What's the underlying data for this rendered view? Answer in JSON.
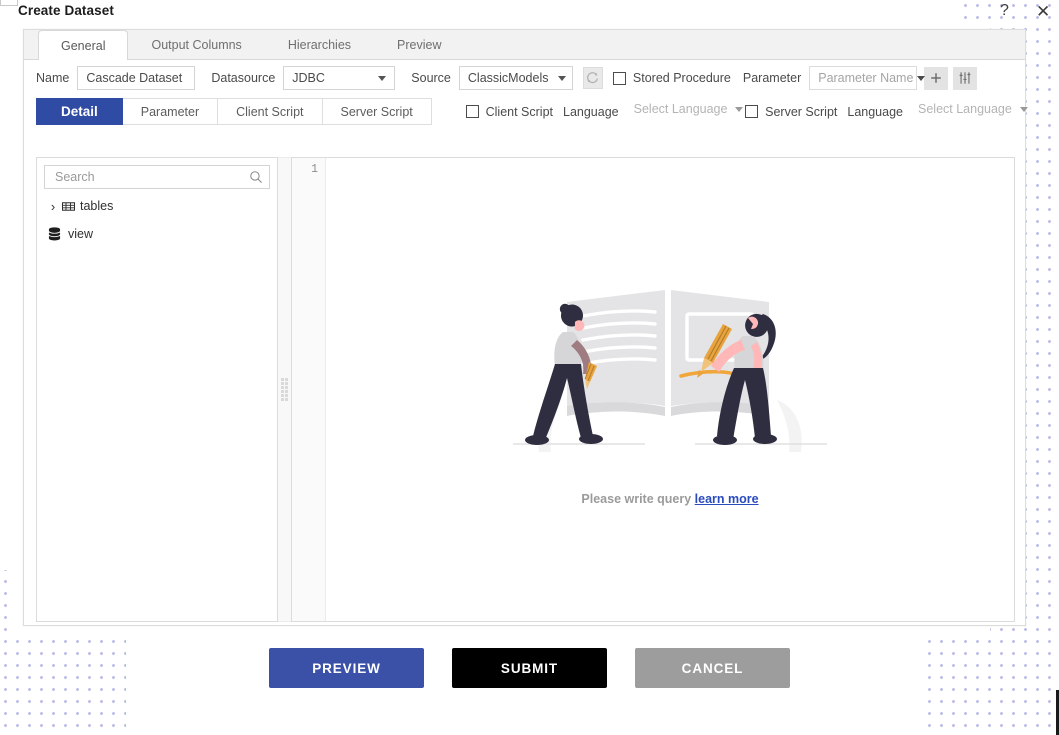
{
  "window": {
    "title": "Create Dataset",
    "help_icon": "question-mark-icon",
    "close_icon": "close-icon"
  },
  "top_tabs": [
    {
      "label": "General",
      "active": true
    },
    {
      "label": "Output Columns",
      "active": false
    },
    {
      "label": "Hierarchies",
      "active": false
    },
    {
      "label": "Preview",
      "active": false
    }
  ],
  "form": {
    "name_label": "Name",
    "name_value": "Cascade Dataset",
    "name_placeholder": "Name",
    "datasource_label": "Datasource",
    "datasource_value": "JDBC",
    "source_label": "Source",
    "source_value": "ClassicModels",
    "refresh_icon": "refresh-icon",
    "stored_procedure_label": "Stored Procedure",
    "stored_procedure_checked": false,
    "parameter_label": "Parameter",
    "parameter_name_value": "Parameter Name",
    "add_icon": "plus-icon",
    "settings_icon": "sliders-icon"
  },
  "sub_tabs": [
    {
      "label": "Detail",
      "active": true
    },
    {
      "label": "Parameter",
      "active": false
    },
    {
      "label": "Client Script",
      "active": false
    },
    {
      "label": "Server Script",
      "active": false
    }
  ],
  "script_options": {
    "client_script_label": "Client Script",
    "client_script_checked": false,
    "client_language_label": "Language",
    "client_language_value": "Select Language",
    "server_script_label": "Server Script",
    "server_script_checked": false,
    "server_language_label": "Language",
    "server_language_value": "Select Language"
  },
  "tree_panel": {
    "search_placeholder": "Search",
    "search_value": "",
    "search_icon": "search-icon",
    "nodes": [
      {
        "label": "tables",
        "icon": "table-grid-icon",
        "expandable": true,
        "chevron": "chevron-right-icon"
      },
      {
        "label": "view",
        "icon": "database-stack-icon",
        "expandable": false,
        "chevron": ""
      }
    ]
  },
  "editor": {
    "line_numbers": [
      "1"
    ],
    "content": "",
    "empty_state": {
      "illustration": "two-people-reading-book-illustration",
      "message": "Please write query",
      "link_text": "learn more"
    }
  },
  "footer": {
    "preview_label": "PREVIEW",
    "submit_label": "SUBMIT",
    "cancel_label": "CANCEL"
  },
  "colors": {
    "accent_blue": "#2f4ba3",
    "preview_blue": "#3b51a8",
    "submit_black": "#000000",
    "cancel_gray": "#9d9d9d",
    "link_blue": "#2a4bbd",
    "dot_pattern": "#b9bbe8",
    "illustration_gray": "#e4e4e6",
    "illustration_dark": "#2f2e41",
    "illustration_orange": "#f0a63a",
    "illustration_skin": "#ffb7b7"
  }
}
